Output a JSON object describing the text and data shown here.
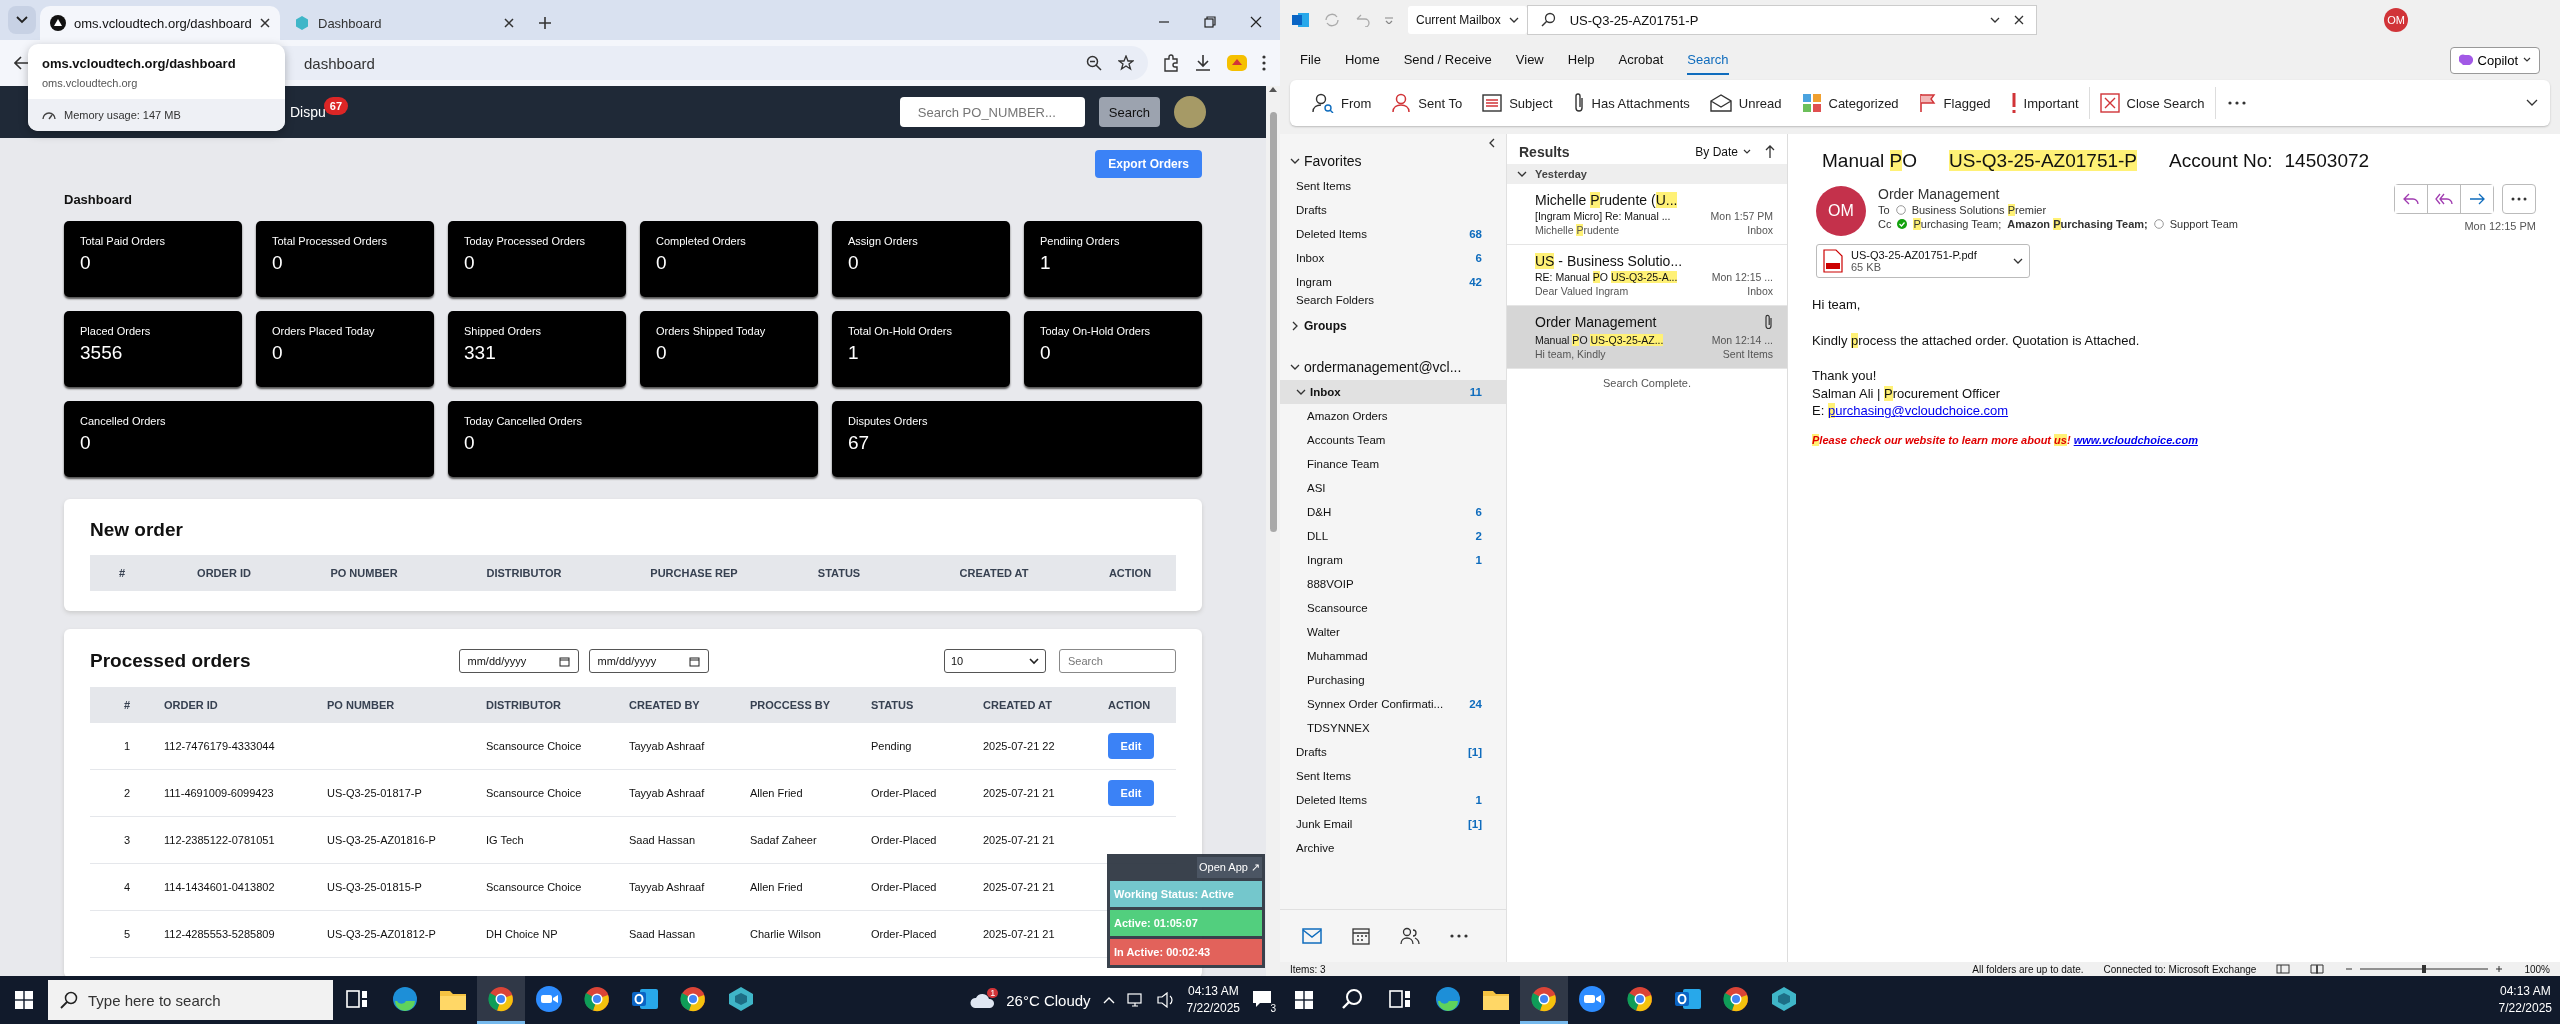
{
  "browser": {
    "tabs": [
      {
        "title": "oms.vcloudtech.org/dashboard",
        "selected": true,
        "kind": "site"
      },
      {
        "title": "Dashboard",
        "selected": false,
        "kind": "app"
      }
    ],
    "address": "dashboard",
    "hover_card": {
      "title": "oms.vcloudtech.org/dashboard",
      "url": "oms.vcloudtech.org",
      "memory": "Memory usage: 147 MB"
    }
  },
  "nav": {
    "link": "Dispu",
    "badge": "67",
    "search_placeholder": "Search PO_NUMBER...",
    "search_button": "Search"
  },
  "export_button": "Export Orders",
  "dashboard_title": "Dashboard",
  "stat_rows": [
    [
      {
        "label": "Total Paid Orders",
        "value": "0"
      },
      {
        "label": "Total Processed Orders",
        "value": "0"
      },
      {
        "label": "Today Processed Orders",
        "value": "0"
      },
      {
        "label": "Completed Orders",
        "value": "0"
      },
      {
        "label": "Assign Orders",
        "value": "0"
      },
      {
        "label": "Pendiing Orders",
        "value": "1"
      }
    ],
    [
      {
        "label": "Placed Orders",
        "value": "3556"
      },
      {
        "label": "Orders Placed Today",
        "value": "0"
      },
      {
        "label": "Shipped Orders",
        "value": "331"
      },
      {
        "label": "Orders Shipped Today",
        "value": "0"
      },
      {
        "label": "Total On-Hold Orders",
        "value": "1"
      },
      {
        "label": "Today On-Hold Orders",
        "value": "0"
      }
    ],
    [
      {
        "label": "Cancelled Orders",
        "value": "0"
      },
      {
        "label": "Today Cancelled Orders",
        "value": "0"
      },
      {
        "label": "Disputes Orders",
        "value": "67"
      }
    ]
  ],
  "new_order": {
    "title": "New order",
    "columns": [
      "#",
      "ORDER ID",
      "PO NUMBER",
      "DISTRIBUTOR",
      "PURCHASE REP",
      "STATUS",
      "CREATED AT",
      "ACTION"
    ]
  },
  "processed": {
    "title": "Processed orders",
    "date_from": "mm/dd/yyyy",
    "date_to": "mm/dd/yyyy",
    "page_size": "10",
    "search_placeholder": "Search",
    "columns": [
      "#",
      "ORDER ID",
      "PO NUMBER",
      "DISTRIBUTOR",
      "CREATED BY",
      "PROCCESS BY",
      "STATUS",
      "CREATED AT",
      "ACTION"
    ],
    "rows": [
      {
        "num": "1",
        "order_id": "112-7476179-4333044",
        "distributor": "Scansource Choice",
        "created_by": "Tayyab Ashraaf",
        "status": "Pending",
        "created_at": "2025-07-21 22",
        "action": "Edit"
      },
      {
        "num": "2",
        "order_id": "111-4691009-6099423",
        "po_number": "US-Q3-25-01817-P",
        "distributor": "Scansource Choice",
        "created_by": "Tayyab Ashraaf",
        "processed_by": "Allen Fried",
        "status": "Order-Placed",
        "created_at": "2025-07-21 21",
        "action": "Edit"
      },
      {
        "num": "3",
        "order_id": "112-2385122-0781051",
        "po_number": "US-Q3-25-AZ01816-P",
        "distributor": "IG Tech",
        "created_by": "Saad Hassan",
        "processed_by": "Sadaf Zaheer",
        "status": "Order-Placed",
        "created_at": "2025-07-21 21"
      },
      {
        "num": "4",
        "order_id": "114-1434601-0413802",
        "po_number": "US-Q3-25-01815-P",
        "distributor": "Scansource Choice",
        "created_by": "Tayyab Ashraaf",
        "processed_by": "Allen Fried",
        "status": "Order-Placed",
        "created_at": "2025-07-21 21"
      },
      {
        "num": "5",
        "order_id": "112-4285553-5285809",
        "po_number": "US-Q3-25-AZ01812-P",
        "distributor": "DH Choice NP",
        "created_by": "Saad Hassan",
        "processed_by": "Charlie Wilson",
        "status": "Order-Placed",
        "created_at": "2025-07-21 21"
      }
    ]
  },
  "widget": {
    "open_app": "Open App ↗",
    "lines": [
      {
        "text": "Working Status: Active",
        "color": "#74c7cc"
      },
      {
        "text": "Active: 01:05:07",
        "color": "#52cf7e"
      },
      {
        "text": "In Active: 00:02:43",
        "color": "#e2625b"
      }
    ]
  },
  "taskbar_left": {
    "search_placeholder": "Type here to search",
    "apps": [
      {
        "kind": "task-view",
        "selected": false
      },
      {
        "kind": "edge",
        "selected": false
      },
      {
        "kind": "files",
        "selected": false
      },
      {
        "kind": "chrome",
        "selected": true
      },
      {
        "kind": "zoom",
        "selected": false
      },
      {
        "kind": "chrome",
        "selected": false
      },
      {
        "kind": "outlook",
        "selected": false
      },
      {
        "kind": "chrome",
        "selected": false
      },
      {
        "kind": "app",
        "selected": false
      }
    ],
    "weather_badge": "1",
    "weather": "26°C Cloudy",
    "time": "04:13 AM",
    "date": "7/22/2025",
    "notifications": "3"
  },
  "outlook": {
    "mailbox_scope": "Current Mailbox",
    "search_value": "US-Q3-25-AZ01751-P",
    "account_initials": "OM",
    "menu": [
      {
        "label": "File",
        "selected": false
      },
      {
        "label": "Home",
        "selected": false
      },
      {
        "label": "Send / Receive",
        "selected": false
      },
      {
        "label": "View",
        "selected": false
      },
      {
        "label": "Help",
        "selected": false
      },
      {
        "label": "Acrobat",
        "selected": false
      },
      {
        "label": "Search",
        "selected": true
      }
    ],
    "copilot": "Copilot",
    "ribbon": [
      {
        "label": "From",
        "kind": "from"
      },
      {
        "label": "Sent To",
        "kind": "sent-to"
      },
      {
        "label": "Subject",
        "kind": "subject"
      },
      {
        "label": "Has Attachments",
        "kind": "attachment"
      },
      {
        "label": "Unread",
        "kind": "unread"
      },
      {
        "label": "Categorized",
        "kind": "categorized"
      },
      {
        "label": "Flagged",
        "kind": "flagged"
      },
      {
        "label": "Important",
        "kind": "important"
      },
      {
        "label": "Close Search",
        "kind": "close"
      }
    ],
    "favorites": {
      "label": "Favorites",
      "expanded": true,
      "items": [
        {
          "name": "Sent Items",
          "selected": false
        },
        {
          "name": "Drafts",
          "selected": false
        },
        {
          "name": "Deleted Items",
          "count": "68",
          "selected": false
        },
        {
          "name": "Inbox",
          "count": "6",
          "selected": false
        },
        {
          "name": "Ingram",
          "count": "42",
          "selected": false
        }
      ]
    },
    "search_folders": "Search Folders",
    "groups": {
      "label": "Groups",
      "expanded": false
    },
    "account": {
      "label": "ordermanagement@vcl...",
      "expanded": true,
      "folders": [
        {
          "name": "Inbox",
          "count": "11",
          "selected": true,
          "expanded": true,
          "children": [
            {
              "name": "Amazon Orders",
              "selected": false
            },
            {
              "name": "Accounts Team",
              "selected": false
            },
            {
              "name": "Finance Team",
              "selected": false
            },
            {
              "name": "ASI",
              "selected": false
            },
            {
              "name": "D&H",
              "count": "6",
              "selected": false
            },
            {
              "name": "DLL",
              "count": "2",
              "selected": false
            },
            {
              "name": "Ingram",
              "count": "1",
              "selected": false
            },
            {
              "name": "888VOIP",
              "selected": false
            },
            {
              "name": "Scansource",
              "selected": false
            },
            {
              "name": "Walter",
              "selected": false
            },
            {
              "name": "Muhammad",
              "selected": false
            },
            {
              "name": "Purchasing",
              "selected": false
            },
            {
              "name": "Synnex Order Confirmati...",
              "count": "24",
              "selected": false
            },
            {
              "name": "TDSYNNEX",
              "selected": false
            }
          ]
        },
        {
          "name": "Drafts",
          "count": "[1]",
          "selected": false
        },
        {
          "name": "Sent Items",
          "selected": false
        },
        {
          "name": "Deleted Items",
          "count": "1",
          "selected": false
        },
        {
          "name": "Junk Email",
          "count": "[1]",
          "selected": false
        },
        {
          "name": "Archive",
          "selected": false
        }
      ]
    },
    "results_label": "Results",
    "sort": "By Date",
    "group": "Yesterday",
    "messages": [
      {
        "sender": [
          {
            "text": "Michelle ",
            "highlight": false
          },
          {
            "text": "P",
            "highlight": true
          },
          {
            "text": "rudente (",
            "highlight": false
          },
          {
            "text": "U...",
            "highlight": true
          }
        ],
        "subject": [
          {
            "text": "[Ingram Micro] Re: Manual ...",
            "highlight": false
          }
        ],
        "time": "Mon 1:57 PM",
        "preview": [
          {
            "text": "Michelle ",
            "highlight": false
          },
          {
            "text": "P",
            "highlight": true
          },
          {
            "text": "rudente",
            "highlight": false
          }
        ],
        "folder": "Inbox",
        "selected": false,
        "attachment": false
      },
      {
        "sender": [
          {
            "text": "US",
            "highlight": true
          },
          {
            "text": " - Business Solutio...",
            "highlight": false
          }
        ],
        "subject": [
          {
            "text": "RE: Manual ",
            "highlight": false
          },
          {
            "text": "P",
            "highlight": true
          },
          {
            "text": "O ",
            "highlight": false
          },
          {
            "text": "US-Q3-25-A...",
            "highlight": true
          }
        ],
        "time": "Mon 12:15 ...",
        "preview": [
          {
            "text": "Dear Valued Ingram",
            "highlight": false
          }
        ],
        "folder": "Inbox",
        "selected": false,
        "attachment": false
      },
      {
        "sender": [
          {
            "text": "Order Management",
            "highlight": false
          }
        ],
        "subject": [
          {
            "text": "Manual ",
            "highlight": false
          },
          {
            "text": "P",
            "highlight": true
          },
          {
            "text": "O    ",
            "highlight": false
          },
          {
            "text": "US-Q3-25-AZ...",
            "highlight": true
          }
        ],
        "time": "Mon 12:14 ...",
        "preview": [
          {
            "text": "Hi team,  Kindly",
            "highlight": false
          }
        ],
        "folder": "Sent Items",
        "selected": true,
        "attachment": true
      }
    ],
    "search_status": "Search Complete.",
    "reading": {
      "subject": [
        {
          "text": "Manual ",
          "highlight": false
        },
        {
          "text": "P",
          "highlight": true
        },
        {
          "text": "O",
          "highlight": false
        }
      ],
      "po": [
        {
          "text": "US-Q3-25-AZ01751-P",
          "highlight": true
        }
      ],
      "account_label": "Account No:",
      "account_no": "14503072",
      "sender": "Order Management",
      "sender_initials": "OM",
      "to_label": "To",
      "cc_label": "Cc",
      "to": [
        {
          "kind": "unknown",
          "name": [
            {
              "text": "Business Solutions ",
              "highlight": false
            },
            {
              "text": "P",
              "highlight": true
            },
            {
              "text": "remier",
              "highlight": false
            }
          ]
        }
      ],
      "cc": [
        {
          "kind": "available",
          "name": [
            {
              "text": "P",
              "highlight": true
            },
            {
              "text": "urchasing Team;",
              "highlight": false
            }
          ]
        },
        {
          "kind": "group",
          "name": [
            {
              "text": "Amazon ",
              "highlight": false
            },
            {
              "text": "P",
              "highlight": true
            },
            {
              "text": "urchasing Team",
              "highlight": false
            }
          ],
          "separator": ";"
        },
        {
          "kind": "unknown",
          "name": [
            {
              "text": "Support Team",
              "highlight": false
            }
          ]
        }
      ],
      "time": "Mon 12:15 PM",
      "attachment": {
        "name": "US-Q3-25-AZ01751-P.pdf",
        "size": "65 KB"
      },
      "greeting": "Hi team,",
      "message": [
        {
          "text": "Kindly ",
          "highlight": false
        },
        {
          "text": "p",
          "highlight": true
        },
        {
          "text": "rocess the attached order. Quotation is Attached.",
          "highlight": false
        }
      ],
      "signoff": "Thank you!",
      "signature": [
        {
          "text": "Salman Ali  | ",
          "highlight": false
        },
        {
          "text": "P",
          "highlight": true
        },
        {
          "text": "rocurement Officer",
          "highlight": false
        }
      ],
      "email_label": "E:",
      "email": [
        {
          "text": "p",
          "highlight": true
        },
        {
          "text": "urchasing@vcloudchoice.com",
          "highlight": false
        }
      ],
      "promo": [
        {
          "text": "P",
          "highlight": true
        },
        {
          "text": "lease check our website to learn more about ",
          "highlight": false
        },
        {
          "text": "us",
          "highlight": true
        },
        {
          "text": "!",
          "highlight": false
        }
      ],
      "promo_link": "www.vcloudchoice.com"
    },
    "status": {
      "items": "Items: 3",
      "sync": "All folders are up to date.",
      "connection": "Connected to: Microsoft Exchange",
      "zoom": "100%",
      "zoom_slider": {
        "level": 0.5
      }
    }
  },
  "taskbar_right": {
    "apps": [
      {
        "kind": "search",
        "selected": false
      },
      {
        "kind": "task-view",
        "selected": false
      },
      {
        "kind": "edge",
        "selected": false
      },
      {
        "kind": "files",
        "selected": false
      },
      {
        "kind": "chrome",
        "selected": true
      },
      {
        "kind": "zoom",
        "selected": false
      },
      {
        "kind": "chrome",
        "selected": false
      },
      {
        "kind": "outlook",
        "selected": false
      },
      {
        "kind": "chrome",
        "selected": false
      },
      {
        "kind": "app",
        "selected": false
      }
    ],
    "time": "04:13 AM",
    "date": "7/22/2025"
  }
}
